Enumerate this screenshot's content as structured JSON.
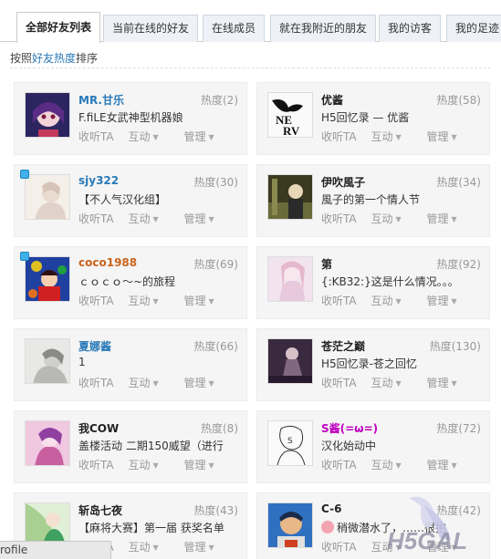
{
  "tabs": [
    {
      "label": "全部好友列表",
      "active": true
    },
    {
      "label": "当前在线的好友"
    },
    {
      "label": "在线成员"
    },
    {
      "label": "就在我附近的朋友"
    },
    {
      "label": "我的访客"
    },
    {
      "label": "我的足迹"
    }
  ],
  "sort": {
    "prefix": "按照",
    "highlight": "好友热度",
    "suffix": "排序"
  },
  "colors": {
    "link": "#2a7ab8",
    "orange": "#c8641a",
    "magenta": "#c000c0",
    "muted": "#999999",
    "online": "#3fb0e8"
  },
  "actions": {
    "follow": "收听TA",
    "interact": "互动",
    "manage": "管理"
  },
  "friends": [
    {
      "name": "MR.甘乐",
      "heat": "热度(2)",
      "status": "F.fiLE女武神型机器娘",
      "name_color": "#2a7ab8",
      "online": false
    },
    {
      "name": "优酱",
      "heat": "热度(58)",
      "status": "H5回忆录 — 优酱",
      "name_color": "#222222",
      "online": false
    },
    {
      "name": "sjy322",
      "heat": "热度(30)",
      "status": "【不人气汉化组】",
      "name_color": "#2a7ab8",
      "online": true
    },
    {
      "name": "伊吹風子",
      "heat": "热度(34)",
      "status": "風子的第一个情人节",
      "name_color": "#222222",
      "online": false
    },
    {
      "name": "coco1988",
      "heat": "热度(69)",
      "status": "ｃｏｃｏ～~的旅程",
      "name_color": "#c8641a",
      "online": true
    },
    {
      "name": "第",
      "heat": "热度(92)",
      "status": "{:KB32:}这是什么情况。。。",
      "name_color": "#222222",
      "online": false
    },
    {
      "name": "夏娜酱",
      "heat": "热度(66)",
      "status": "1",
      "name_color": "#2a7ab8",
      "online": false
    },
    {
      "name": "苍茫之巅",
      "heat": "热度(130)",
      "status": "H5回忆录-苍之回忆",
      "name_color": "#222222",
      "online": false
    },
    {
      "name": "我COW",
      "heat": "热度(8)",
      "status": "盖楼活动 二期150威望（进行",
      "name_color": "#222222",
      "online": false
    },
    {
      "name": "S酱(=ω=)",
      "heat": "热度(72)",
      "status": "汉化始动中",
      "name_color": "#c000c0",
      "online": false
    },
    {
      "name": "斩岛七夜",
      "heat": "热度(43)",
      "status": "【麻将大赛】第一届 获奖名单",
      "name_color": "#222222",
      "online": false
    },
    {
      "name": "C-6",
      "heat": "热度(42)",
      "status": "稍微潜水了，……很抱",
      "name_color": "#222222",
      "online": false
    }
  ],
  "browser_status": "rofile",
  "watermark": "H5GAL"
}
